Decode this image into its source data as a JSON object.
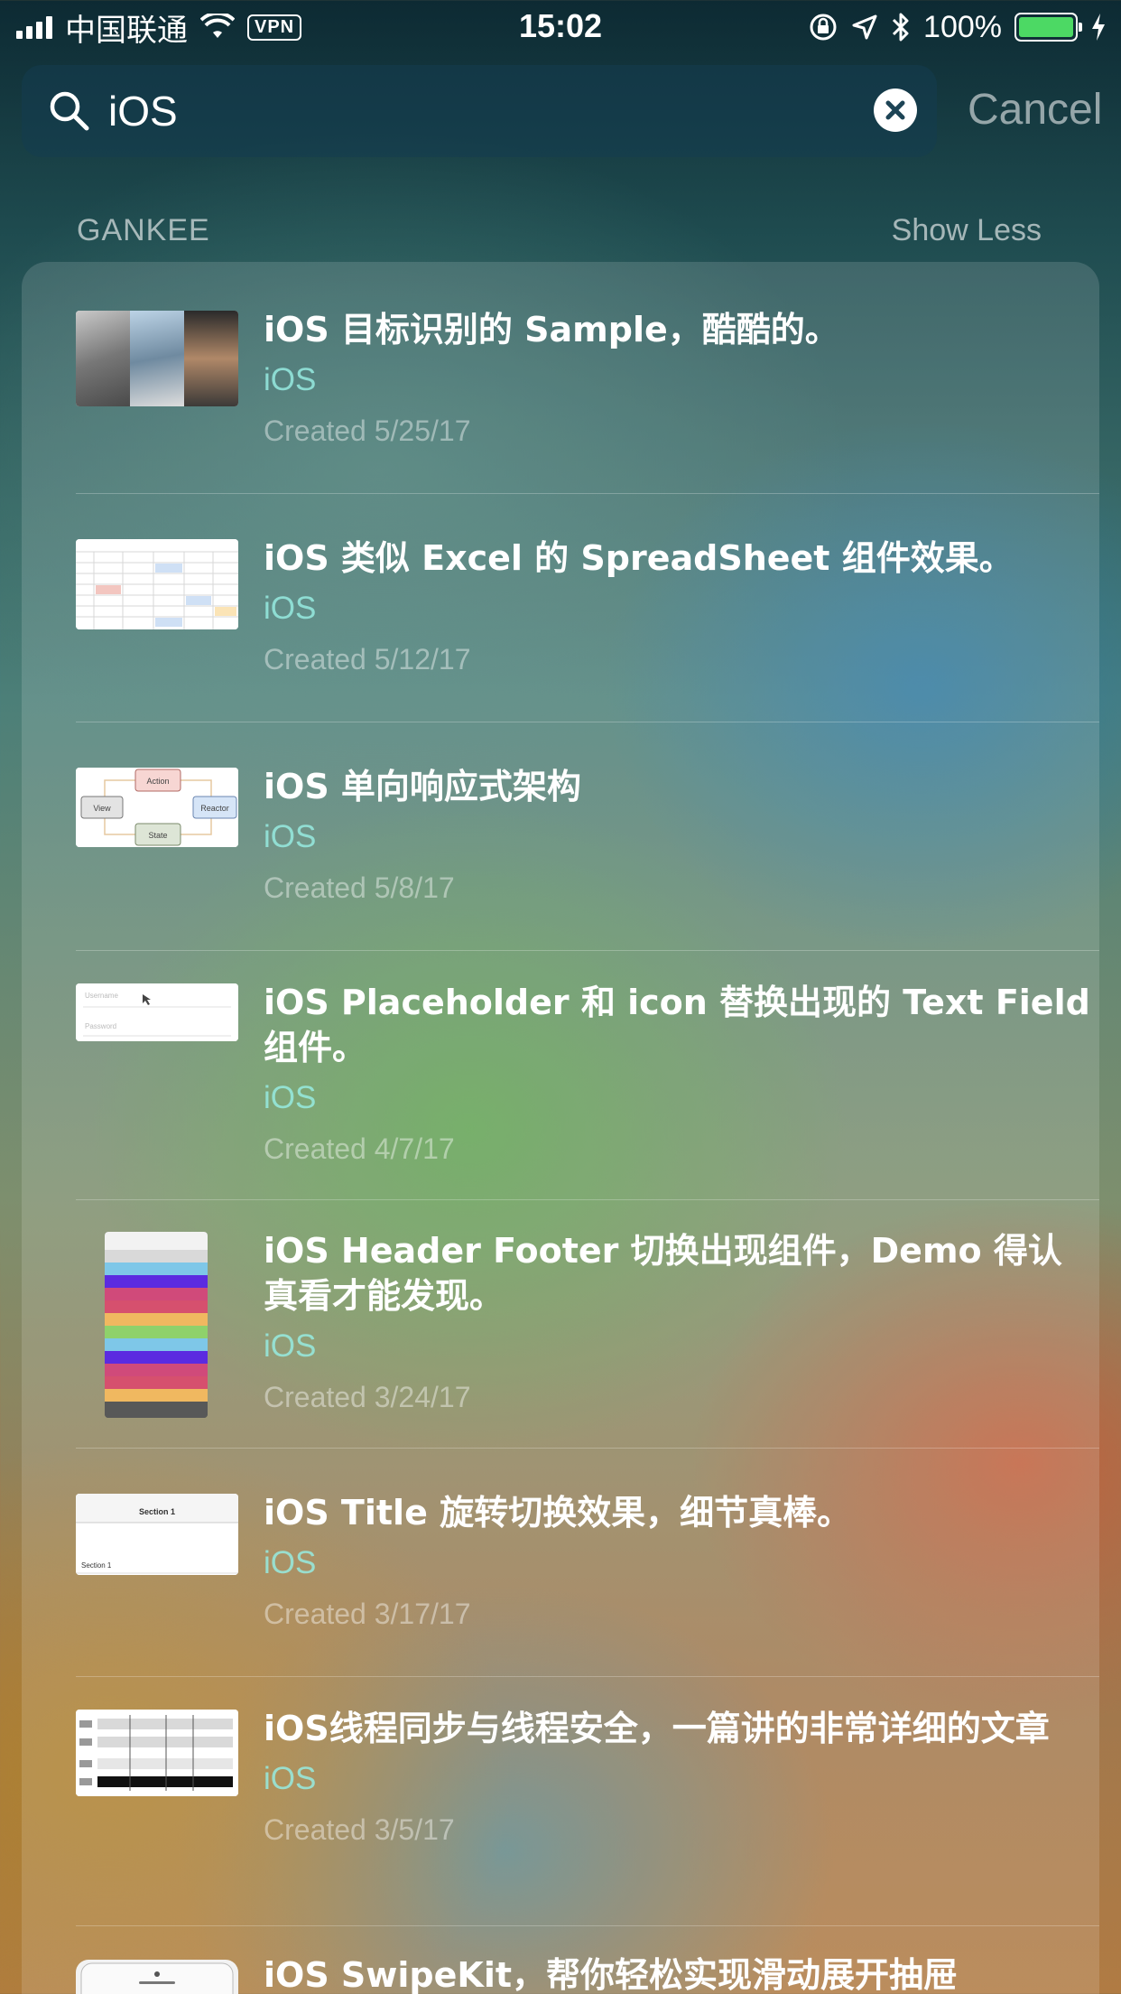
{
  "status_bar": {
    "carrier": "中国联通",
    "vpn": "VPN",
    "time": "15:02",
    "battery": "100%",
    "battery_color": "#4cd964"
  },
  "search": {
    "query": "iOS",
    "cancel_label": "Cancel"
  },
  "section": {
    "title": "GANKEE",
    "toggle_label": "Show Less"
  },
  "results": [
    {
      "title": "iOS 目标识别的 Sample，酷酷的。",
      "tag": "iOS",
      "date": "Created 5/25/17"
    },
    {
      "title": "iOS 类似 Excel 的 SpreadSheet 组件效果。",
      "tag": "iOS",
      "date": "Created 5/12/17"
    },
    {
      "title": "iOS 单向响应式架构",
      "tag": "iOS",
      "date": "Created 5/8/17",
      "thumb_labels": {
        "top": "Action",
        "left": "View",
        "right": "Reactor",
        "bottom": "State"
      }
    },
    {
      "title": "iOS Placeholder 和 icon 替换出现的 Text Field 组件。",
      "tag": "iOS",
      "date": "Created 4/7/17",
      "thumb_labels": {
        "top": "Username",
        "bottom": "Password"
      }
    },
    {
      "title": "iOS Header Footer 切换出现组件，Demo 得认真看才能发现。",
      "tag": "iOS",
      "date": "Created 3/24/17"
    },
    {
      "title": "iOS Title 旋转切换效果，细节真棒。",
      "tag": "iOS",
      "date": "Created 3/17/17",
      "thumb_labels": {
        "header": "Section 1",
        "row": "Section 1"
      }
    },
    {
      "title": "iOS线程同步与线程安全，一篇讲的非常详细的文章",
      "tag": "iOS",
      "date": "Created 3/5/17"
    },
    {
      "title": "iOS SwipeKit，帮你轻松实现滑动展开抽屉",
      "tag": "",
      "date": ""
    }
  ]
}
